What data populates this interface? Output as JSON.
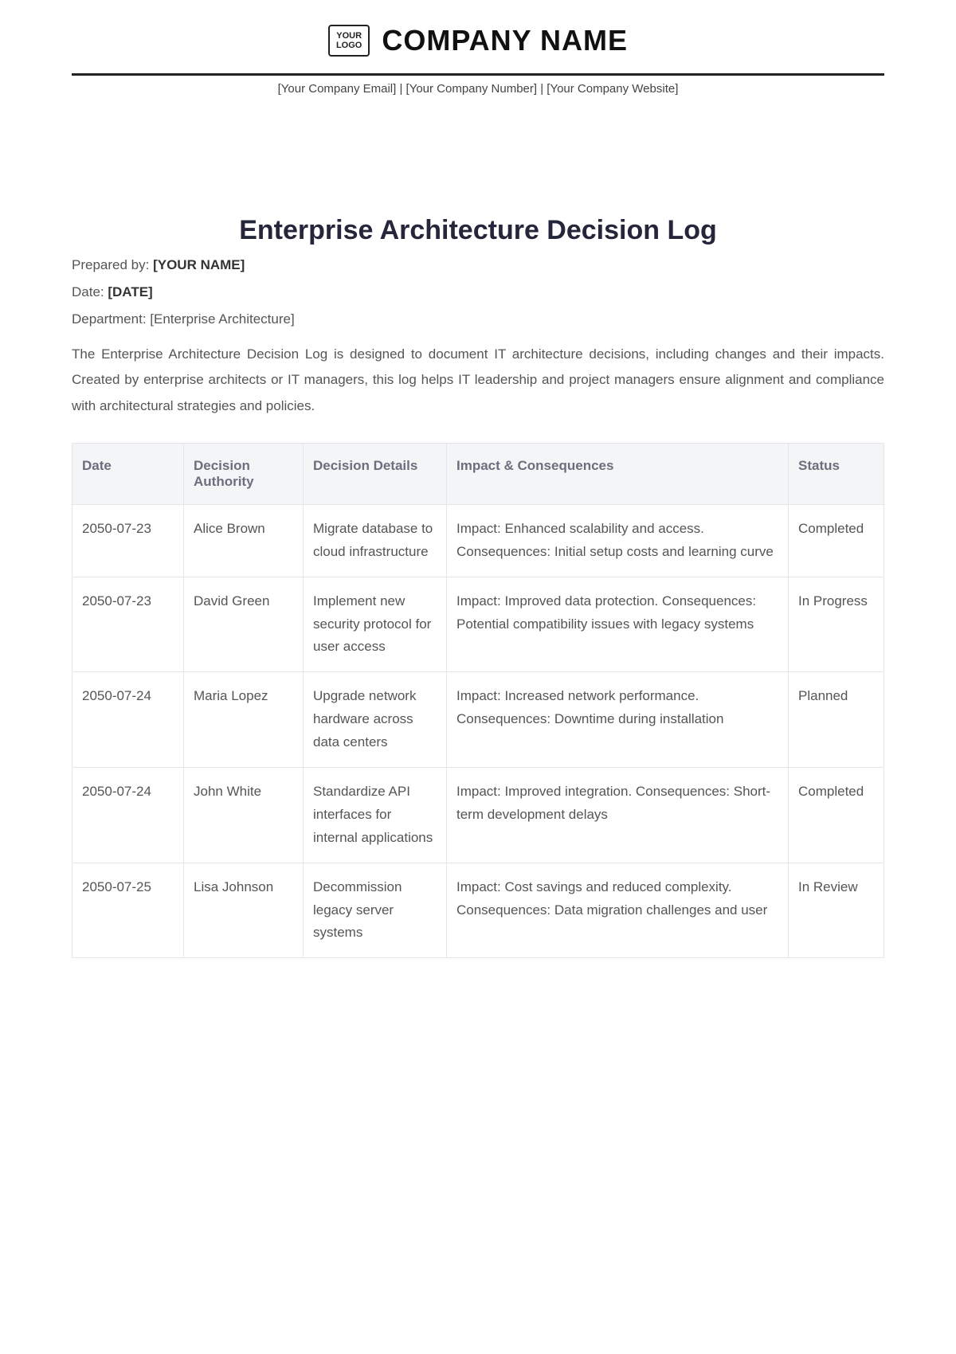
{
  "header": {
    "logo_text": "YOUR\nLOGO",
    "company_name": "COMPANY NAME",
    "contact_line": "[Your Company Email] | [Your Company Number] | [Your Company Website]"
  },
  "document": {
    "title": "Enterprise Architecture Decision Log",
    "prepared_by_label": "Prepared by: ",
    "prepared_by_value": "[YOUR NAME]",
    "date_label": "Date: ",
    "date_value": "[DATE]",
    "department_line": "Department: [Enterprise Architecture]",
    "description": "The Enterprise Architecture Decision Log is designed to document IT architecture decisions, including changes and their impacts. Created by enterprise architects or IT managers, this log helps IT leadership and project managers ensure alignment and compliance with architectural strategies and policies."
  },
  "table": {
    "headers": {
      "date": "Date",
      "authority": "Decision Authority",
      "details": "Decision Details",
      "impact": "Impact & Consequences",
      "status": "Status"
    },
    "rows": [
      {
        "date": "2050-07-23",
        "authority": "Alice Brown",
        "details": "Migrate database to cloud infrastructure",
        "impact": "Impact: Enhanced scalability and access. Consequences: Initial setup costs and learning curve",
        "status": "Completed"
      },
      {
        "date": "2050-07-23",
        "authority": "David Green",
        "details": "Implement new security protocol for user access",
        "impact": "Impact: Improved data protection. Consequences: Potential compatibility issues with legacy systems",
        "status": "In Progress"
      },
      {
        "date": "2050-07-24",
        "authority": "Maria Lopez",
        "details": "Upgrade network hardware across data centers",
        "impact": "Impact: Increased network performance. Consequences: Downtime during installation",
        "status": "Planned"
      },
      {
        "date": "2050-07-24",
        "authority": "John White",
        "details": "Standardize API interfaces for internal applications",
        "impact": "Impact: Improved integration. Consequences: Short-term development delays",
        "status": "Completed"
      },
      {
        "date": "2050-07-25",
        "authority": "Lisa Johnson",
        "details": "Decommission legacy server systems",
        "impact": "Impact: Cost savings and reduced complexity. Consequences: Data migration challenges and user",
        "status": "In Review"
      }
    ]
  }
}
